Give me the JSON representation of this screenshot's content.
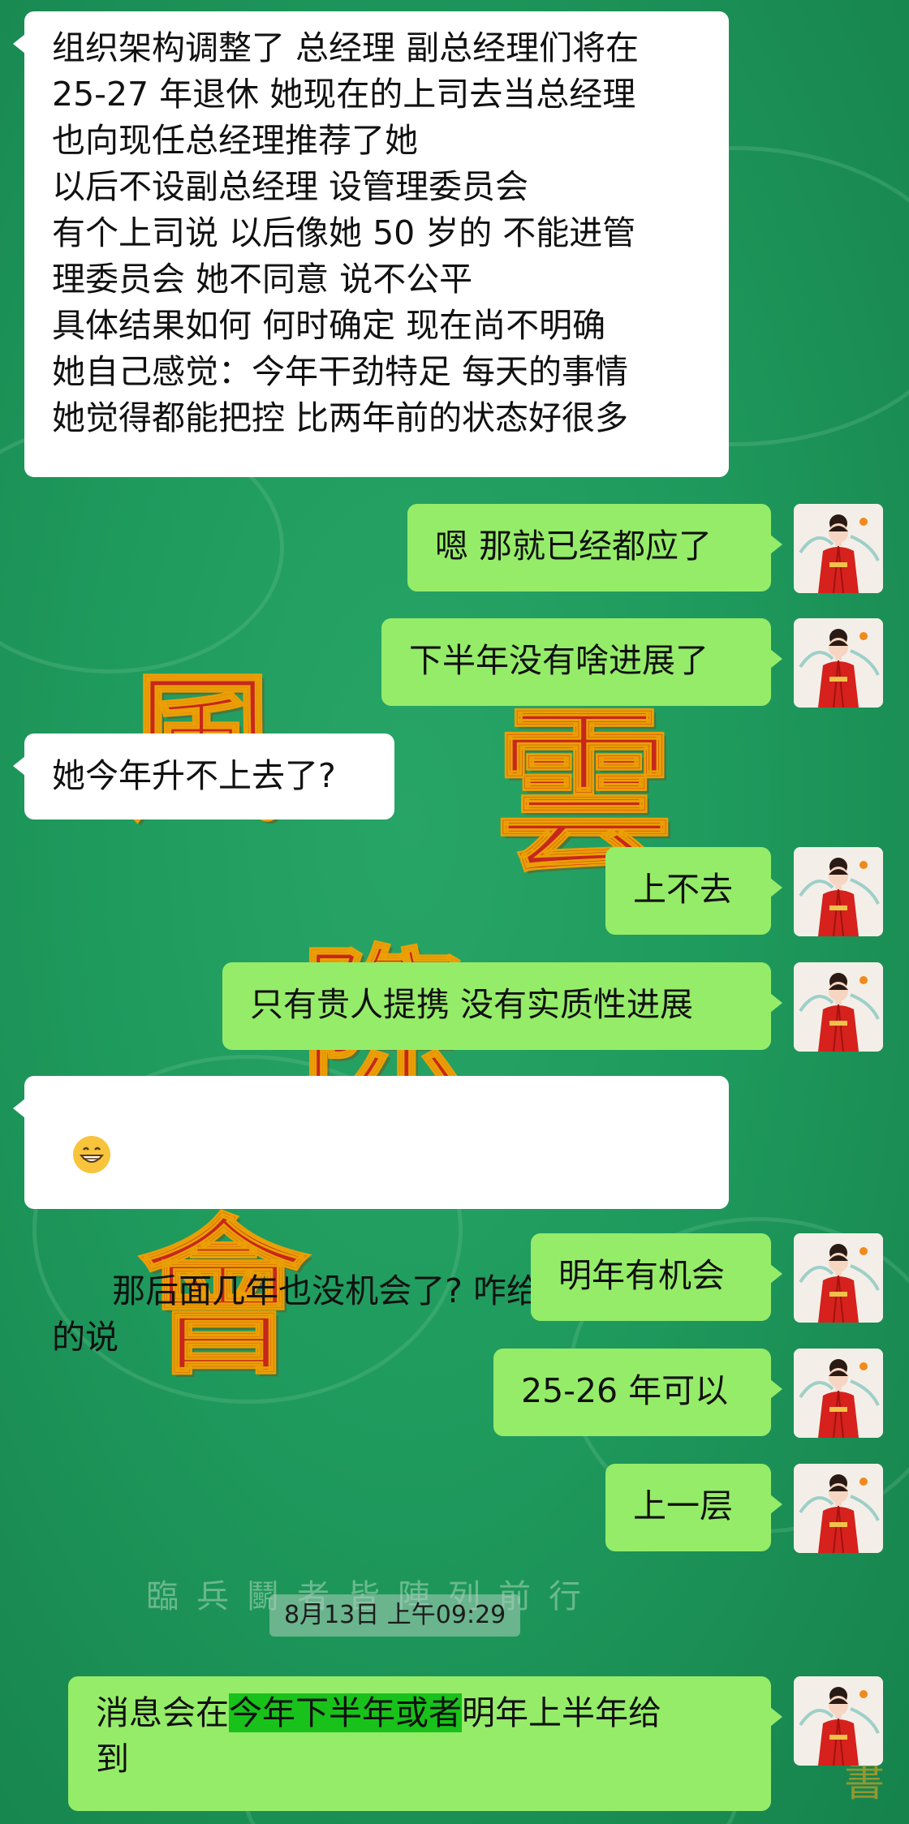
{
  "conversation": {
    "messages": [
      {
        "id": "m1",
        "side": "left",
        "text": "组织架构调整了 总经理 副总经理们将在\n25-27 年退休 她现在的上司去当总经理\n也向现任总经理推荐了她\n以后不设副总经理 设管理委员会\n有个上司说 以后像她 50 岁的 不能进管\n理委员会 她不同意 说不公平\n具体结果如何 何时确定 现在尚不明确\n她自己感觉：今年干劲特足 每天的事情\n她觉得都能把控 比两年前的状态好很多"
      },
      {
        "id": "m2",
        "side": "right",
        "text": "嗯 那就已经都应了"
      },
      {
        "id": "m3",
        "side": "right",
        "text": "下半年没有啥进展了"
      },
      {
        "id": "m4",
        "side": "left",
        "text": "她今年升不上去了?"
      },
      {
        "id": "m5",
        "side": "right",
        "text": "上不去"
      },
      {
        "id": "m6",
        "side": "right",
        "text": "只有贵人提携 没有实质性进展"
      },
      {
        "id": "m7",
        "side": "left",
        "emoji": "grinning-face",
        "text": "那后面几年也没机会了? 咋给她 委婉\n的说"
      },
      {
        "id": "m8",
        "side": "right",
        "text": "明年有机会"
      },
      {
        "id": "m9",
        "side": "right",
        "text": "25-26 年可以"
      },
      {
        "id": "m10",
        "side": "right",
        "text": "上一层"
      },
      {
        "id": "m11",
        "side": "right",
        "text_before": "消息会在",
        "text_highlight": "今年下半年或者",
        "text_after": "明年上半年给\n到"
      }
    ],
    "timestamp": "8月13日 上午09:29"
  },
  "background": {
    "motto": "臨兵鬭者皆陣列前行",
    "glyphs": [
      "風",
      "雲",
      "際",
      "會"
    ],
    "colors": {
      "base": "#1f9a5d",
      "glyph": "#d0201a",
      "glyph_outline": "#f5a000"
    }
  },
  "avatar": {
    "icon": "avatar-red-robed-woman"
  },
  "colors": {
    "bubble_left": "#ffffff",
    "bubble_right": "#95ec69",
    "highlight": "#18c21a"
  }
}
